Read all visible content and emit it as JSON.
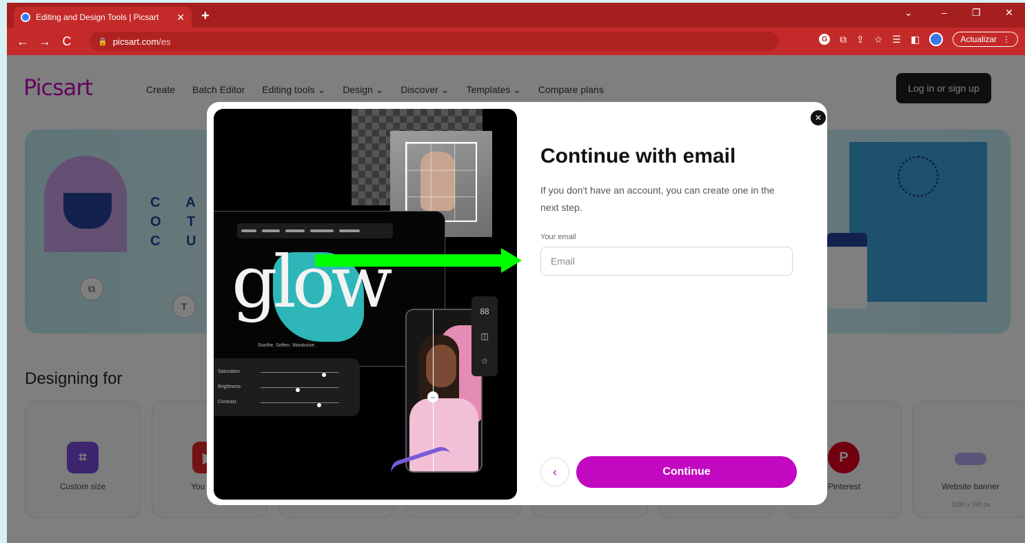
{
  "browser": {
    "tab_title": "Editing and Design Tools | Picsart",
    "tab_close": "✕",
    "new_tab": "+",
    "url_host": "picsart.com",
    "url_path": "/es",
    "update_label": "Actualizar",
    "window_controls": [
      "⌄",
      "–",
      "❐",
      "✕"
    ],
    "nav": [
      "←",
      "→",
      "C"
    ]
  },
  "site": {
    "logo": "Picsart",
    "nav": [
      "Create",
      "Batch Editor",
      "Editing tools ⌄",
      "Design ⌄",
      "Discover ⌄",
      "Templates ⌄",
      "Compare plans"
    ],
    "login_label": "Log in or sign up",
    "hero_letters": "C A N\nO T H\nC U",
    "designing_for": "Designing for",
    "cards": [
      {
        "label": "Custom size",
        "icon": "crop-icon",
        "color": "#7b4cde",
        "glyph": "⌗"
      },
      {
        "label": "You",
        "icon": "youtube-icon",
        "color": "#e8262b",
        "glyph": ""
      },
      {
        "label": "",
        "icon": "",
        "color": "",
        "glyph": ""
      },
      {
        "label": "",
        "icon": "",
        "color": "",
        "glyph": ""
      },
      {
        "label": "",
        "icon": "",
        "color": "",
        "glyph": ""
      },
      {
        "label": "",
        "icon": "",
        "color": "",
        "glyph": ""
      },
      {
        "label": "Pinterest",
        "icon": "pinterest-icon",
        "color": "#e60023",
        "glyph": "P"
      },
      {
        "label": "Website banner",
        "icon": "banner-icon",
        "color": "#b9a6f0",
        "glyph": "",
        "sub": "1280 x 768 px"
      }
    ]
  },
  "modal": {
    "title": "Continue with email",
    "subtitle": "If you don't have an account, you can create one in the next step.",
    "email_label": "Your email",
    "email_placeholder": "Email",
    "email_value": "",
    "continue_label": "Continue",
    "back_label": "‹",
    "close_label": "✕",
    "art": {
      "glow": "glow",
      "tagline": "Soothe. Soften. Moisturize.",
      "adjust": [
        {
          "label": "Saturation",
          "level": 0.78
        },
        {
          "label": "Brightness",
          "level": 0.45
        },
        {
          "label": "Contrast",
          "level": 0.72
        }
      ],
      "side_tools": [
        "88",
        "◫",
        "☆"
      ]
    }
  },
  "annotation": {
    "color": "#00ff00"
  }
}
